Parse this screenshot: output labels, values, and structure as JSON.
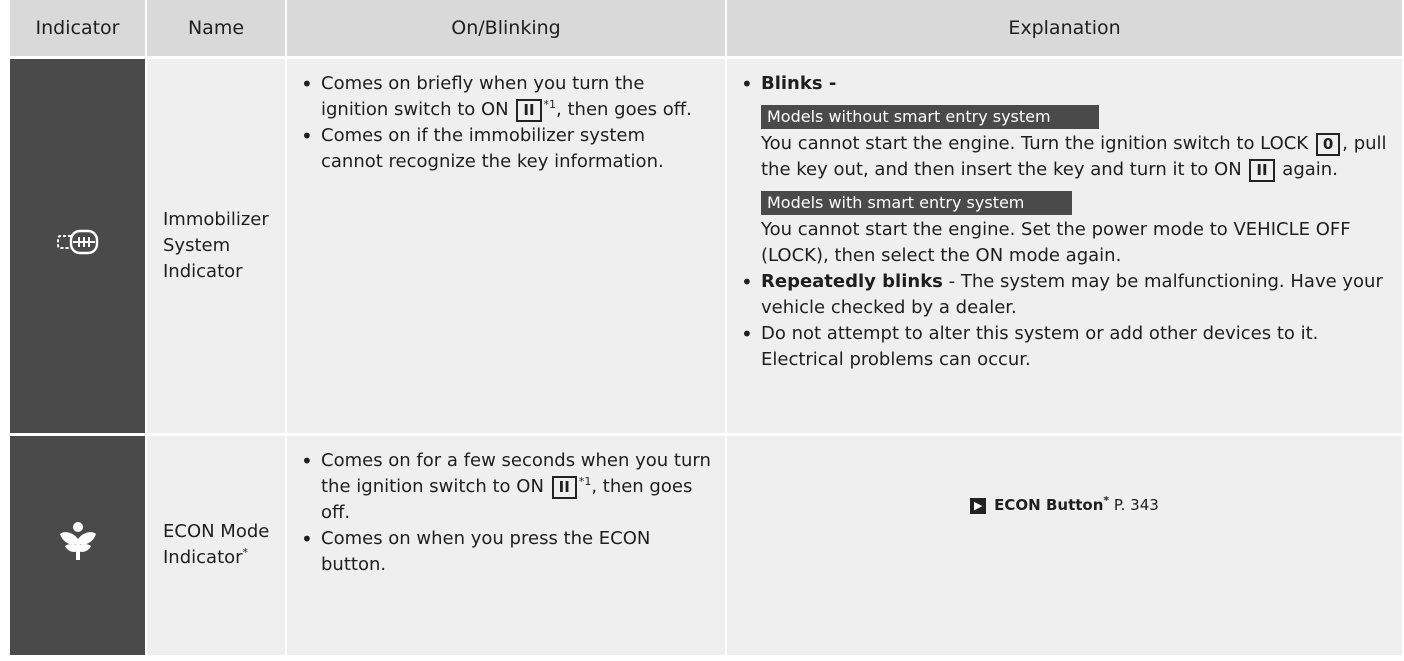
{
  "headers": [
    "Indicator",
    "Name",
    "On/Blinking",
    "Explanation"
  ],
  "rows": [
    {
      "icon": "key-immobilizer-icon",
      "name": "Immobilizer System Indicator",
      "on_items": [
        [
          "Comes on briefly when you turn the ignition switch to ON ",
          "II",
          "*1",
          ", then goes off."
        ],
        [
          "Comes on if the immobilizer system cannot recognize the key information."
        ]
      ],
      "explanation": {
        "blinks_label": "Blinks -",
        "tag_without": "Models without smart entry system",
        "text_without_1": "You cannot start the engine. Turn the ignition switch to LOCK ",
        "lock_pos": "0",
        "text_without_2": ", pull the key out, and then insert the key and turn it to ON ",
        "on_pos": "II",
        "text_without_3": " again.",
        "tag_with": "Models with smart entry system",
        "text_with": "You cannot start the engine. Set the power mode to VEHICLE OFF (LOCK), then select the ON mode again.",
        "repeat_label": "Repeatedly blinks",
        "repeat_text": " - The system may be malfunctioning. Have your vehicle checked by a dealer.",
        "warning": "Do not attempt to alter this system or add other devices to it. Electrical problems can occur."
      }
    },
    {
      "icon": "econ-leaf-icon",
      "name": "ECON Mode Indicator",
      "name_sup": "*",
      "on_items": [
        [
          "Comes on for a few seconds when you turn the ignition switch to ON ",
          "II",
          "*1",
          ", then goes off."
        ],
        [
          "Comes on when you press the ECON button."
        ]
      ],
      "reference": {
        "label": "ECON Button",
        "sup": "*",
        "page": " P. 343"
      }
    }
  ],
  "colors": {
    "header_bg": "#d9d9d9",
    "cell_bg": "#efefef",
    "icon_bg": "#4a4a4a"
  }
}
